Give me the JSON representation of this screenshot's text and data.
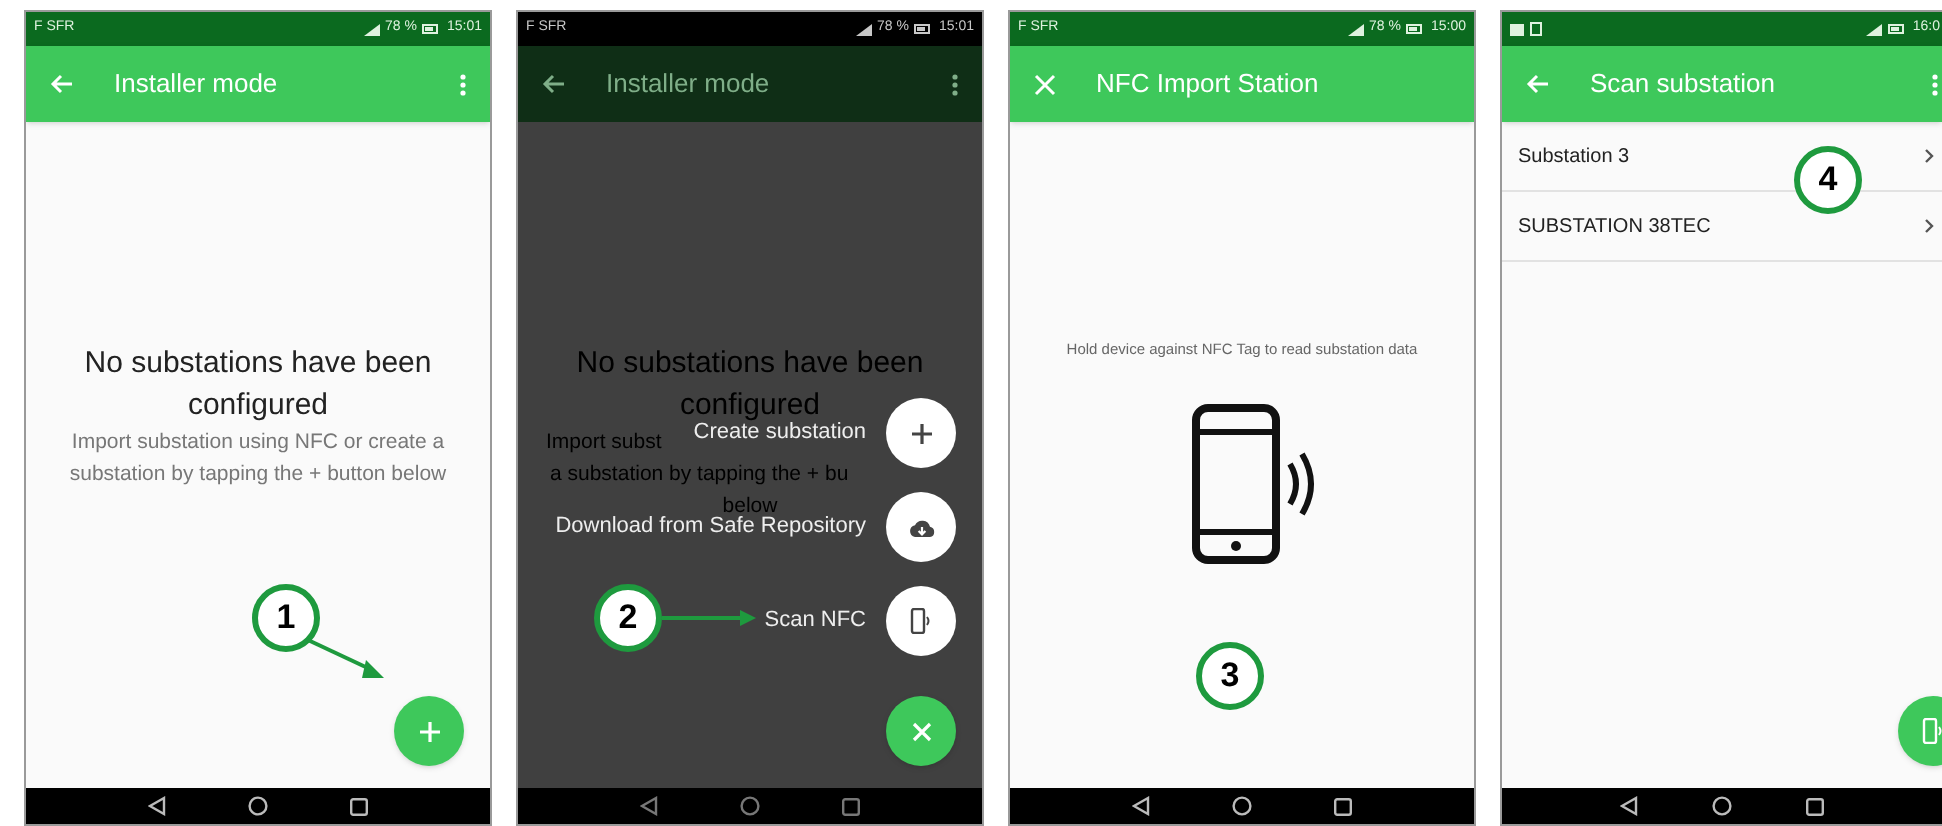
{
  "phones": [
    {
      "kind": "empty",
      "status_bar": {
        "carrier": "F SFR",
        "battery": "78 %",
        "time": "15:01"
      },
      "app_bar": {
        "title": "Installer mode"
      },
      "empty_state": {
        "title": "No substations have been configured",
        "message": "Import substation using NFC or create a substation by tapping the + button below"
      },
      "callout": {
        "number": "1"
      }
    },
    {
      "kind": "speed_dial",
      "status_bar": {
        "carrier": "F SFR",
        "battery": "78 %",
        "time": "15:01"
      },
      "app_bar": {
        "title": "Installer mode"
      },
      "empty_state": {
        "title": "No substations have been configured",
        "message_lines": [
          "Import subst",
          "a substation by tapping the + bu",
          "below"
        ]
      },
      "speed_dial": [
        {
          "label": "Create substation"
        },
        {
          "label": "Download from Safe Repository"
        },
        {
          "label": "Scan NFC"
        }
      ],
      "callout": {
        "number": "2"
      }
    },
    {
      "kind": "nfc",
      "status_bar": {
        "carrier": "F SFR",
        "battery": "78 %",
        "time": "15:00"
      },
      "app_bar": {
        "title": "NFC Import Station"
      },
      "message": "Hold device against NFC Tag to read substation data",
      "callout": {
        "number": "3"
      }
    },
    {
      "kind": "list",
      "status_bar": {
        "time": "16:0"
      },
      "app_bar": {
        "title": "Scan substation"
      },
      "items": [
        {
          "label": "Substation 3"
        },
        {
          "label": "SUBSTATION 38TEC"
        }
      ],
      "callout": {
        "number": "4"
      }
    }
  ]
}
